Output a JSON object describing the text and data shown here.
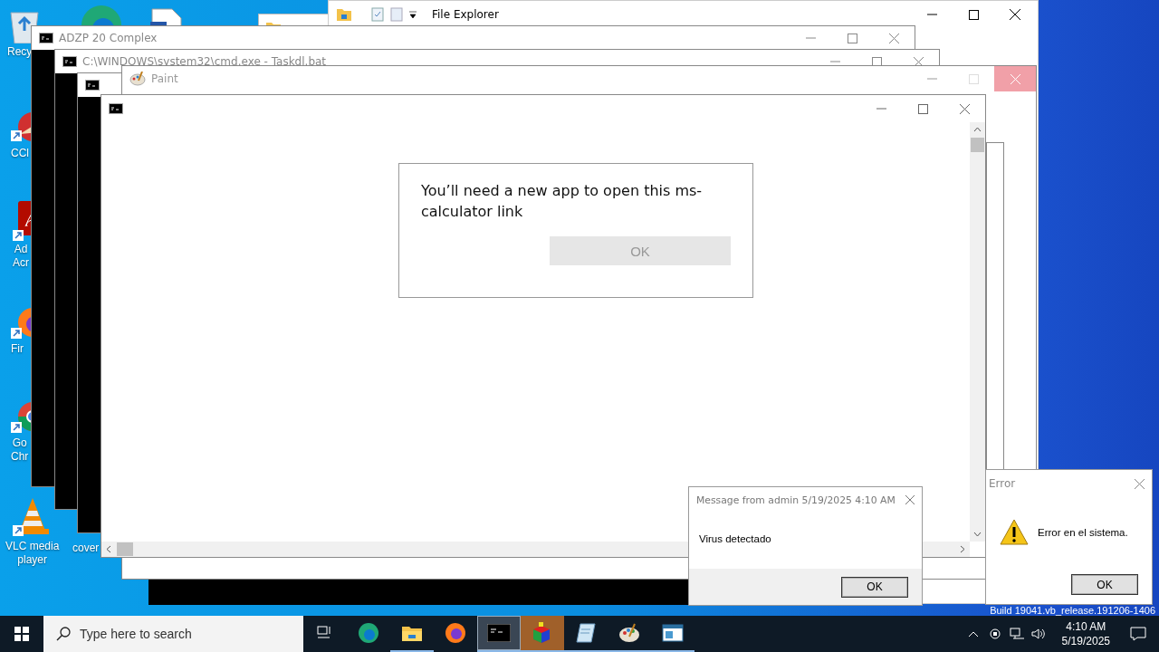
{
  "desktop_icons": [
    {
      "kind": "recycle-bin",
      "lines": [
        "Recy"
      ]
    },
    {
      "kind": "edge"
    },
    {
      "kind": "document"
    },
    {
      "kind": "ccleaner",
      "lines": [
        "CCl"
      ]
    },
    {
      "kind": "acrobat",
      "lines": [
        "Ad",
        "Acr"
      ]
    },
    {
      "kind": "firefox",
      "lines": [
        "Fir"
      ]
    },
    {
      "kind": "chrome",
      "lines": [
        "Go",
        "Chr"
      ]
    },
    {
      "kind": "vlc",
      "lines": [
        "VLC media",
        "player"
      ]
    },
    {
      "kind": "file",
      "lines": [
        "cover"
      ]
    }
  ],
  "file_explorer": {
    "title": "File Explorer"
  },
  "console_windows": [
    {
      "title": "ADZP 20 Complex"
    },
    {
      "title": "C:\\WINDOWS\\system32\\cmd.exe - Taskdl.bat"
    }
  ],
  "paint": {
    "title": "Paint"
  },
  "app_prompt": {
    "message": "You’ll need a new app to open this ms-calculator link",
    "button": "OK"
  },
  "message_dialog": {
    "title": "Message from admin 5/19/2025 4:10 AM",
    "text": "Virus detectado",
    "button": "OK"
  },
  "error_dialog": {
    "title": "Error",
    "text": "Error en el sistema.",
    "button": "OK"
  },
  "build_text": "Build 19041.vb_release.191206-1406",
  "taskbar": {
    "search_placeholder": "Type here to search",
    "apps": [
      {
        "kind": "task-view",
        "running": false,
        "selected": false,
        "flashing": false
      },
      {
        "kind": "edge",
        "running": false,
        "selected": false,
        "flashing": false
      },
      {
        "kind": "explorer",
        "running": true,
        "selected": false,
        "flashing": false
      },
      {
        "kind": "firefox",
        "running": false,
        "selected": false,
        "flashing": false
      },
      {
        "kind": "console",
        "running": true,
        "selected": true,
        "flashing": false
      },
      {
        "kind": "cube",
        "running": true,
        "selected": false,
        "flashing": true
      },
      {
        "kind": "notepad",
        "running": true,
        "selected": false,
        "flashing": false
      },
      {
        "kind": "paint",
        "running": true,
        "selected": false,
        "flashing": false
      },
      {
        "kind": "window",
        "running": true,
        "selected": false,
        "flashing": false
      }
    ],
    "time": "4:10 AM",
    "date": "5/19/2025"
  }
}
